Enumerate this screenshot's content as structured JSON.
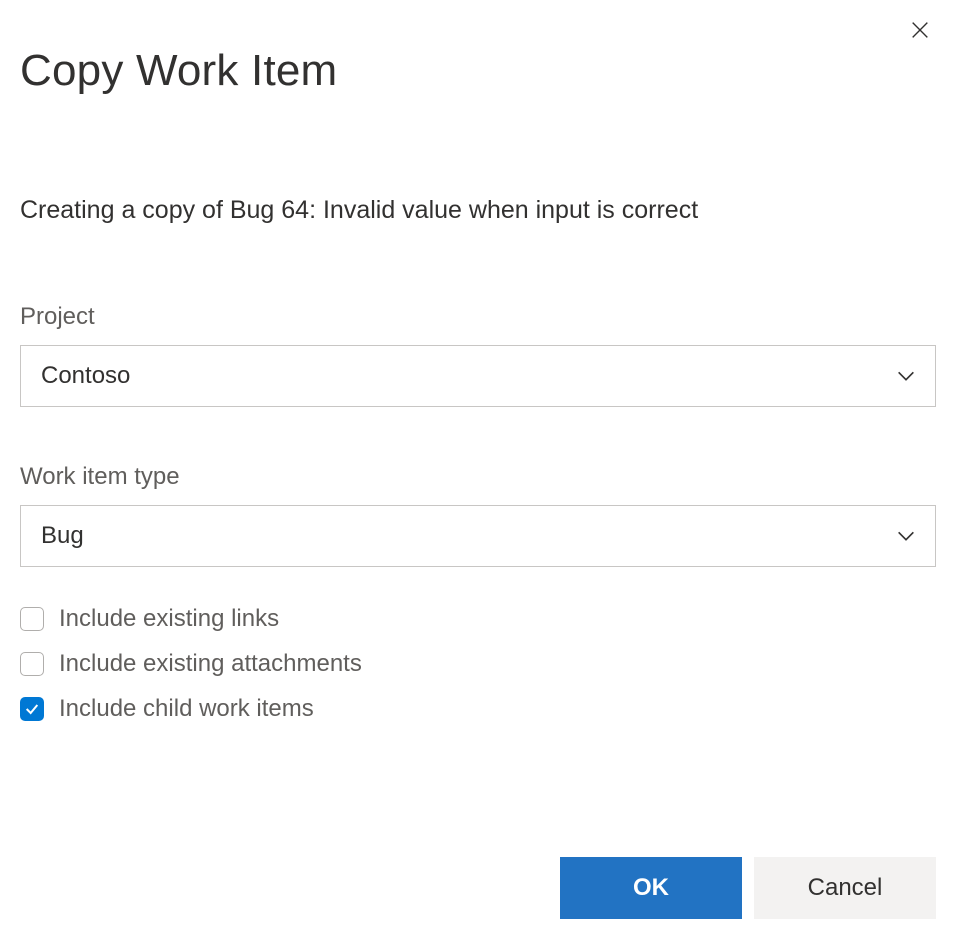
{
  "dialog": {
    "title": "Copy Work Item",
    "subtitle": "Creating a copy of Bug 64: Invalid value when input is correct"
  },
  "fields": {
    "project": {
      "label": "Project",
      "value": "Contoso"
    },
    "workItemType": {
      "label": "Work item type",
      "value": "Bug"
    }
  },
  "options": {
    "includeLinks": {
      "label": "Include existing links",
      "checked": false
    },
    "includeAttachments": {
      "label": "Include existing attachments",
      "checked": false
    },
    "includeChildItems": {
      "label": "Include child work items",
      "checked": true
    }
  },
  "buttons": {
    "ok": "OK",
    "cancel": "Cancel"
  }
}
